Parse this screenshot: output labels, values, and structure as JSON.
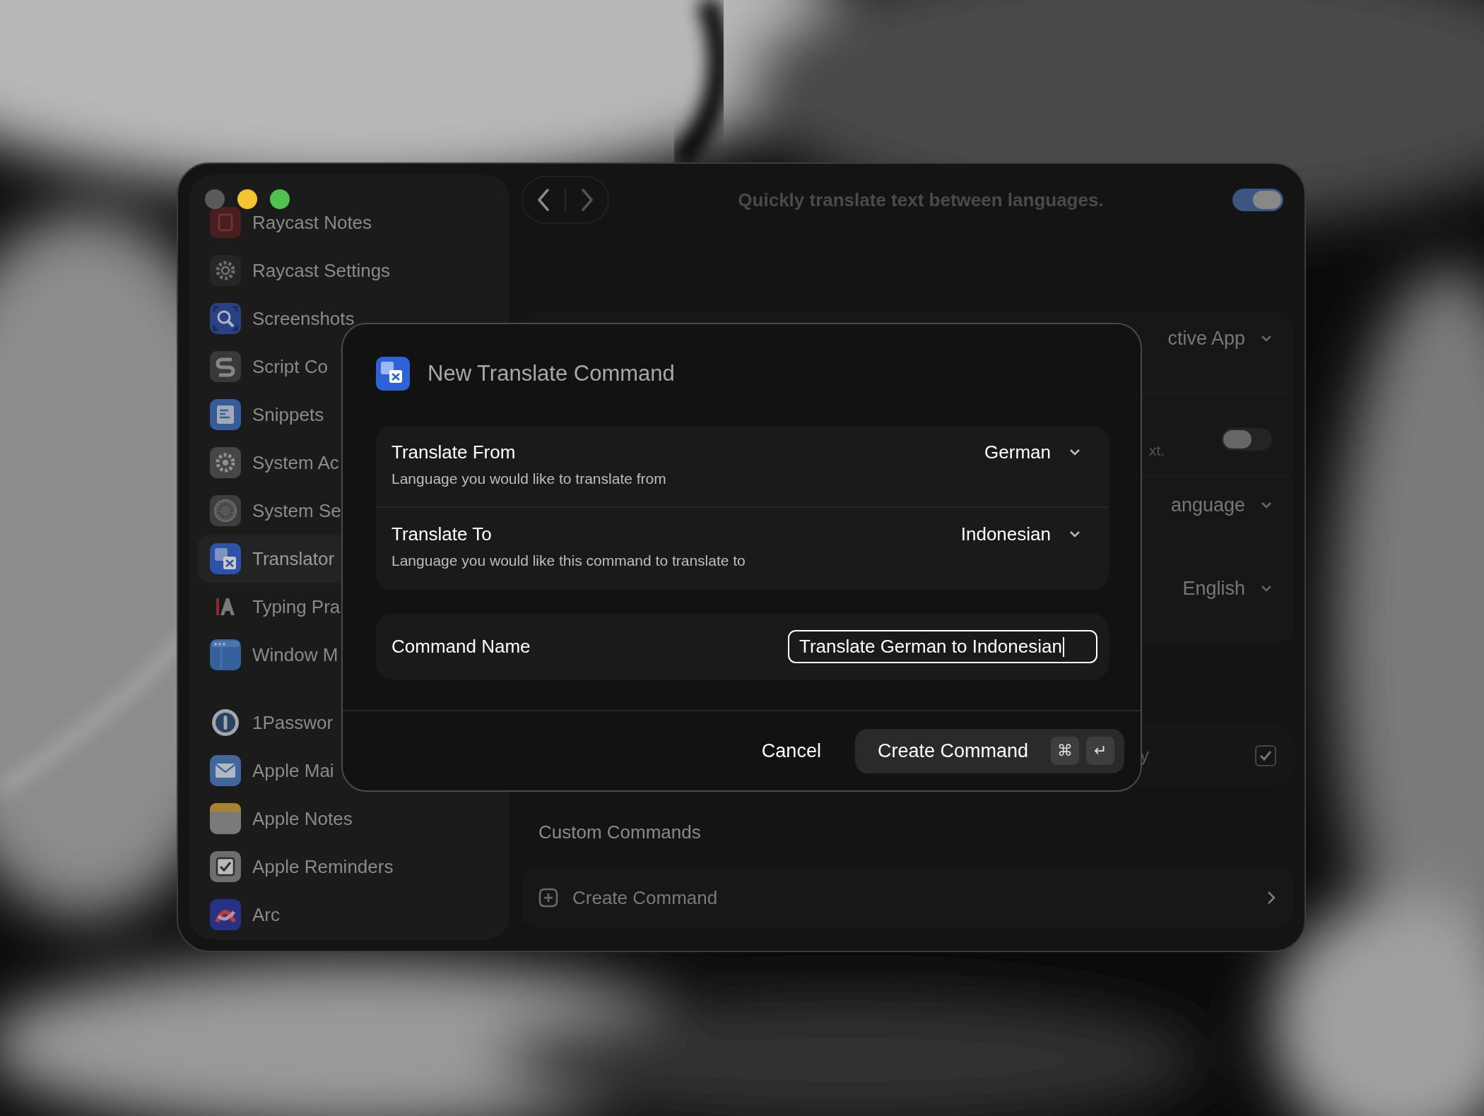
{
  "sidebar": {
    "groups": [
      {
        "items": [
          {
            "label": "Raycast Notes",
            "selected": false
          },
          {
            "label": "Raycast Settings",
            "selected": false
          },
          {
            "label": "Screenshots",
            "selected": false
          },
          {
            "label": "Script Co",
            "selected": false
          },
          {
            "label": "Snippets",
            "selected": false
          },
          {
            "label": "System Ac",
            "selected": false
          },
          {
            "label": "System Se",
            "selected": false
          },
          {
            "label": "Translator",
            "selected": true
          },
          {
            "label": "Typing Pra",
            "selected": false
          },
          {
            "label": "Window M",
            "selected": false
          }
        ]
      },
      {
        "items": [
          {
            "label": "1Passwor",
            "selected": false
          },
          {
            "label": "Apple Mai",
            "selected": false
          },
          {
            "label": "Apple Notes",
            "selected": false
          },
          {
            "label": "Apple Reminders",
            "selected": false
          },
          {
            "label": "Arc",
            "selected": false
          }
        ]
      }
    ]
  },
  "toolbar": {
    "title": "Quickly translate text between languages.",
    "enabled": true
  },
  "settings": {
    "rows": [
      {
        "kind": "select",
        "value": "ctive App"
      },
      {
        "kind": "toggle",
        "description": "xt.",
        "on": false
      },
      {
        "kind": "select",
        "value": "anguage"
      },
      {
        "kind": "select",
        "value": "English"
      }
    ]
  },
  "commands": {
    "items": [
      {
        "hotkey": "y",
        "enabled": true
      }
    ]
  },
  "custom_commands": {
    "heading": "Custom Commands",
    "create_label": "Create Command"
  },
  "dialog": {
    "title": "New Translate Command",
    "groups": [
      [
        {
          "kind": "select",
          "label": "Translate From",
          "description": "Language you would like to translate from",
          "value": "German"
        },
        {
          "kind": "select",
          "label": "Translate To",
          "description": "Language you would like this command to translate to",
          "value": "Indonesian"
        }
      ],
      [
        {
          "kind": "text",
          "label": "Command Name",
          "value": "Translate German to Indonesian"
        }
      ]
    ],
    "buttons": [
      {
        "kind": "plain",
        "label": "Cancel"
      },
      {
        "kind": "primary",
        "label": "Create Command",
        "shortcut": [
          "⌘",
          "↵"
        ]
      }
    ]
  }
}
